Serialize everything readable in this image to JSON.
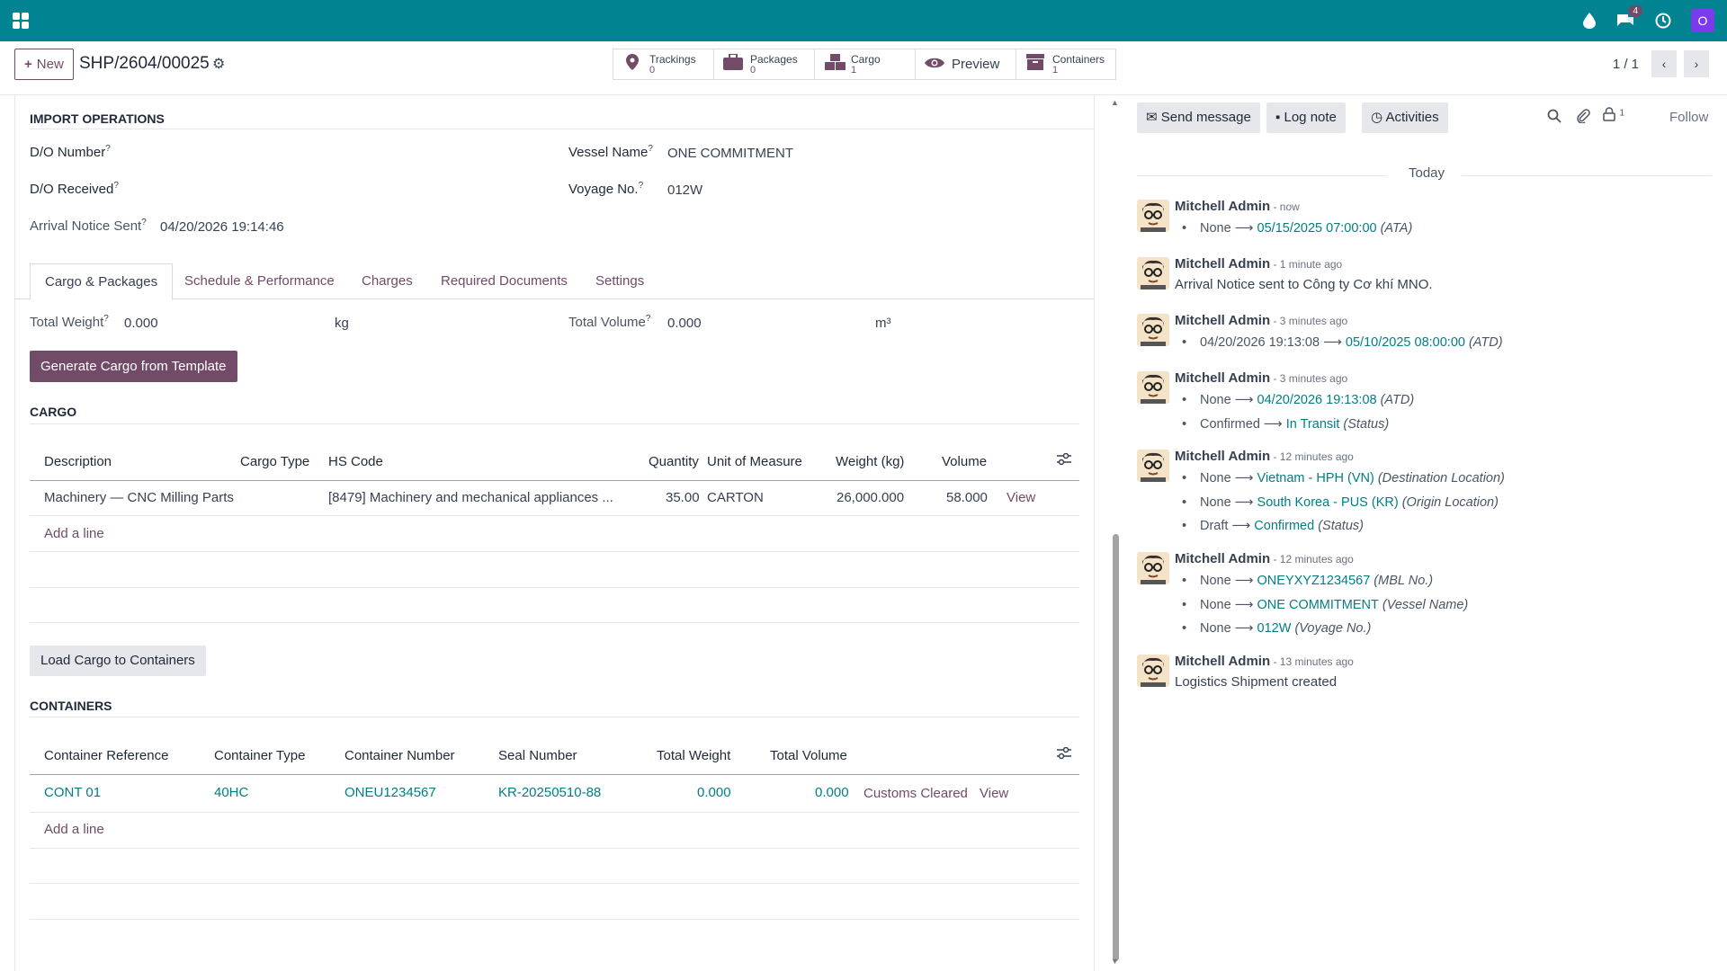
{
  "navbar": {
    "notif_count": "4"
  },
  "control": {
    "new_label": "New",
    "record_name": "SHP/2604/00025",
    "smart_buttons": [
      {
        "label": "Trackings",
        "value": "0"
      },
      {
        "label": "Packages",
        "value": "0"
      },
      {
        "label": "Cargo",
        "value": "1"
      },
      {
        "label": "Preview",
        "value": ""
      },
      {
        "label": "Containers",
        "value": "1"
      }
    ],
    "pager": "1 / 1"
  },
  "import_ops": {
    "title": "IMPORT OPERATIONS",
    "do_number_label": "D/O Number",
    "do_received_label": "D/O Received",
    "arrival_label": "Arrival Notice Sent",
    "arrival_value": "04/20/2026 19:14:46",
    "vessel_label": "Vessel Name",
    "vessel_value": "ONE COMMITMENT",
    "voyage_label": "Voyage No.",
    "voyage_value": "012W"
  },
  "tabs": [
    "Cargo & Packages",
    "Schedule & Performance",
    "Charges",
    "Required Documents",
    "Settings"
  ],
  "totals": {
    "weight_label": "Total Weight",
    "weight_value": "0.000",
    "weight_unit": "kg",
    "volume_label": "Total Volume",
    "volume_value": "0.000",
    "volume_unit": "m³"
  },
  "generate_btn": "Generate Cargo from Template",
  "cargo": {
    "title": "CARGO",
    "headers": [
      "Description",
      "Cargo Type",
      "HS Code",
      "Quantity",
      "Unit of Measure",
      "Weight (kg)",
      "Volume"
    ],
    "row": {
      "description": "Machinery — CNC Milling Parts",
      "hs_code": "[8479] Machinery and mechanical appliances ...",
      "quantity": "35.00",
      "uom": "CARTON",
      "weight": "26,000.000",
      "volume": "58.000",
      "view": "View"
    },
    "add_line": "Add a line"
  },
  "load_btn": "Load Cargo to Containers",
  "containers": {
    "title": "CONTAINERS",
    "headers": [
      "Container Reference",
      "Container Type",
      "Container Number",
      "Seal Number",
      "Total Weight",
      "Total Volume"
    ],
    "row": {
      "ref": "CONT 01",
      "type": "40HC",
      "number": "ONEU1234567",
      "seal": "KR-20250510-88",
      "weight": "0.000",
      "volume": "0.000",
      "status": "Customs Cleared",
      "view": "View"
    },
    "add_line": "Add a line"
  },
  "chatter": {
    "send_message": "Send message",
    "log_note": "Log note",
    "activities": "Activities",
    "followers_count": "1",
    "follow": "Follow",
    "today": "Today",
    "messages": [
      {
        "author": "Mitchell Admin",
        "time": "- now",
        "lines": [
          {
            "old": "None",
            "new": "05/15/2025 07:00:00",
            "field": "(ATA)"
          }
        ]
      },
      {
        "author": "Mitchell Admin",
        "time": "- 1 minute ago",
        "body": "Arrival Notice sent to Công ty Cơ khí MNO."
      },
      {
        "author": "Mitchell Admin",
        "time": "- 3 minutes ago",
        "lines": [
          {
            "old": "04/20/2026 19:13:08",
            "new": "05/10/2025 08:00:00",
            "field": "(ATD)"
          }
        ]
      },
      {
        "author": "Mitchell Admin",
        "time": "- 3 minutes ago",
        "lines": [
          {
            "old": "None",
            "new": "04/20/2026 19:13:08",
            "field": "(ATD)"
          },
          {
            "old": "Confirmed",
            "new": "In Transit",
            "field": "(Status)"
          }
        ]
      },
      {
        "author": "Mitchell Admin",
        "time": "- 12 minutes ago",
        "lines": [
          {
            "old": "None",
            "new": "Vietnam - HPH (VN)",
            "field": "(Destination Location)"
          },
          {
            "old": "None",
            "new": "South Korea - PUS (KR)",
            "field": "(Origin Location)"
          },
          {
            "old": "Draft",
            "new": "Confirmed",
            "field": "(Status)"
          }
        ]
      },
      {
        "author": "Mitchell Admin",
        "time": "- 12 minutes ago",
        "lines": [
          {
            "old": "None",
            "new": "ONEYXYZ1234567",
            "field": "(MBL No.)"
          },
          {
            "old": "None",
            "new": "ONE COMMITMENT",
            "field": "(Vessel Name)"
          },
          {
            "old": "None",
            "new": "012W",
            "field": "(Voyage No.)"
          }
        ]
      },
      {
        "author": "Mitchell Admin",
        "time": "- 13 minutes ago",
        "body": "Logistics Shipment created"
      }
    ]
  }
}
